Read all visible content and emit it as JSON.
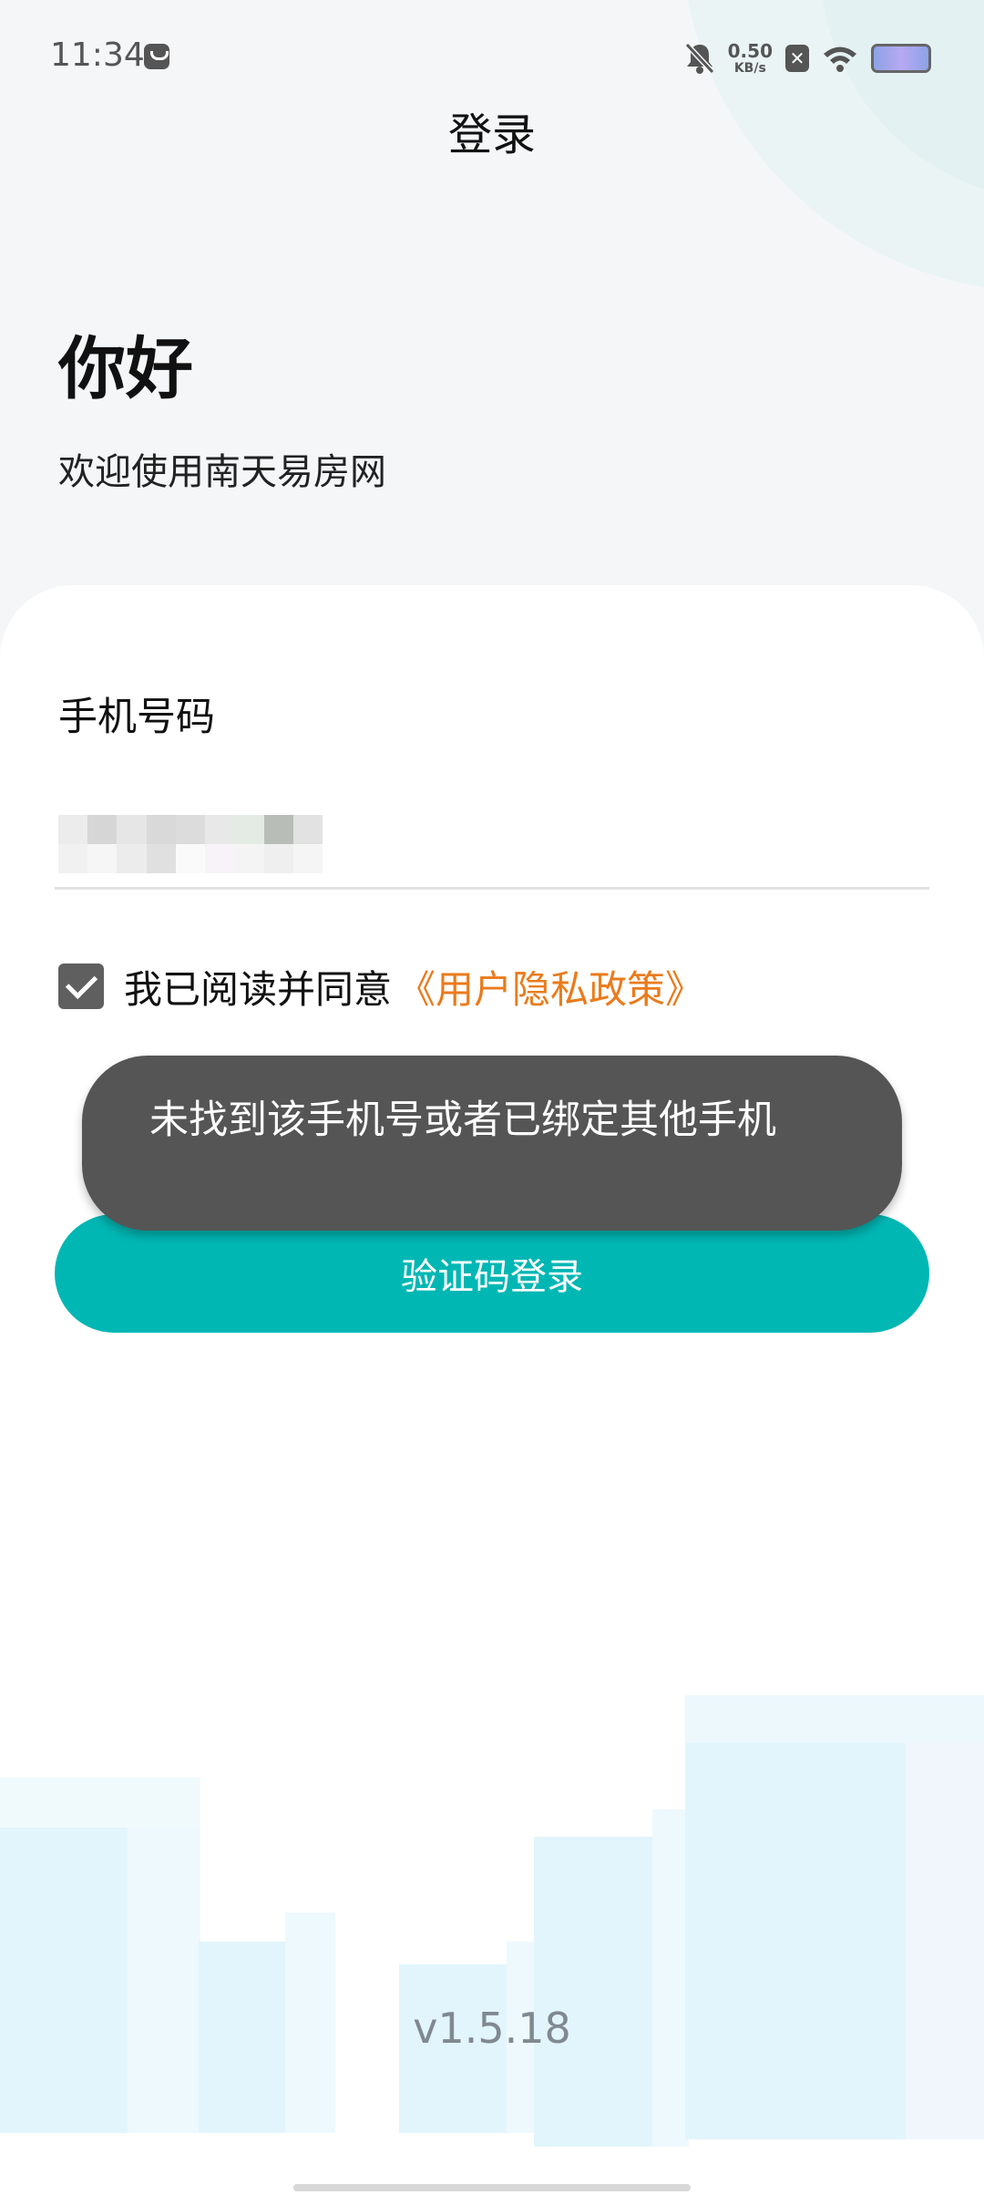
{
  "status_bar": {
    "time": "11:34",
    "net_speed_value": "0.50",
    "net_speed_unit": "KB/s",
    "icons": [
      "message-icon",
      "bell-off-icon",
      "sim-off-icon",
      "wifi-icon",
      "battery-icon"
    ]
  },
  "header": {
    "title": "登录"
  },
  "hero": {
    "greeting": "你好",
    "welcome": "欢迎使用南天易房网"
  },
  "form": {
    "phone_label": "手机号码",
    "phone_value": "",
    "agree_checked": true,
    "agree_text": "我已阅读并同意",
    "policy_link": "《用户隐私政策》",
    "login_button": "验证码登录"
  },
  "toast": {
    "message": "未找到该手机号或者已绑定其他手机"
  },
  "footer": {
    "version": "v1.5.18"
  },
  "colors": {
    "accent": "#00b7b4",
    "link": "#ea7b1c",
    "toast_bg": "#555555",
    "checkbox": "#5f5f5f"
  }
}
